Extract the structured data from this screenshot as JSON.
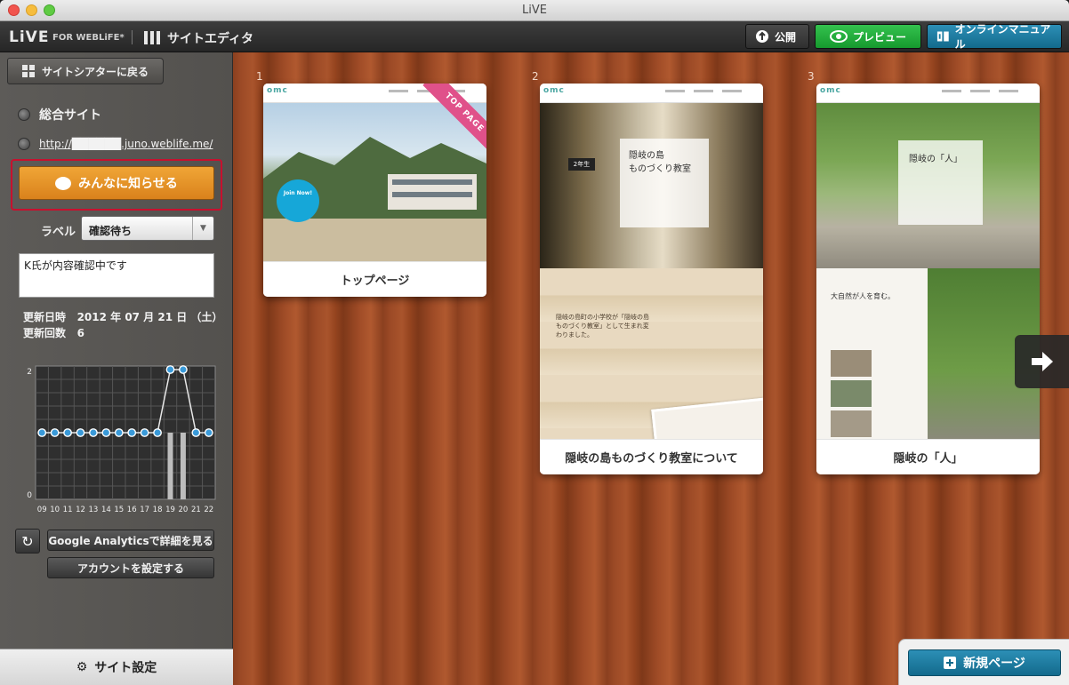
{
  "window": {
    "title": "LiVE"
  },
  "appbar": {
    "logo": "LiVE",
    "logo_sub": "FOR WEBLiFE*",
    "mode": "サイトエディタ",
    "publish_label": "公開",
    "preview_label": "プレビュー",
    "manual_label": "オンラインマニュアル"
  },
  "sidebar": {
    "back_label": "サイトシアターに戻る",
    "site_name": "総合サイト",
    "site_url": "http://██████.juno.weblife.me/",
    "notify_label": "みんなに知らせる",
    "label_caption": "ラベル",
    "label_value": "確認待ち",
    "memo": "K氏が内容確認中です",
    "updated_caption": "更新日時",
    "updated_value": "2012 年 07 月 21 日 （土）",
    "count_caption": "更新回数",
    "count_value": "6",
    "ga_button": "Google Analyticsで詳細を見る",
    "account_button": "アカウントを設定する",
    "settings_label": "サイト設定"
  },
  "chart_data": {
    "type": "line",
    "x": [
      "09",
      "10",
      "11",
      "12",
      "13",
      "14",
      "15",
      "16",
      "17",
      "18",
      "19",
      "20",
      "21",
      "22"
    ],
    "series": [
      {
        "values": [
          1,
          1,
          1,
          1,
          1,
          1,
          1,
          1,
          1,
          1,
          2,
          2,
          1,
          1
        ]
      }
    ],
    "bars": [
      0,
      0,
      0,
      0,
      0,
      0,
      0,
      0,
      0,
      0,
      1,
      1,
      0,
      0
    ],
    "ylim": [
      0,
      2
    ],
    "yticks": [
      "0",
      "2"
    ],
    "grid": true
  },
  "pages": [
    {
      "num": "1",
      "title": "トップページ",
      "badge": "TOP PAGE",
      "thumb_text": "Join Now!"
    },
    {
      "num": "2",
      "title": "隠岐の島ものづくり教室について",
      "thumb_heading": "隠岐の島\nものづくり教室",
      "thumb_sign": "2年生",
      "thumb_text": "隠岐の島町の小学校が「隠岐の島ものづくり教室」として生まれ変わりました。"
    },
    {
      "num": "3",
      "title": "隠岐の「人」",
      "thumb_heading": "隠岐の「人」",
      "thumb_text": "大自然が人を育む。"
    }
  ],
  "new_page_label": "新規ページ",
  "colors": {
    "accent_orange": "#e8961f",
    "preview_green": "#1faa38",
    "manual_blue": "#1e7ea3",
    "highlight_red": "#c8102e",
    "chart_point": "#3a9ad9"
  }
}
